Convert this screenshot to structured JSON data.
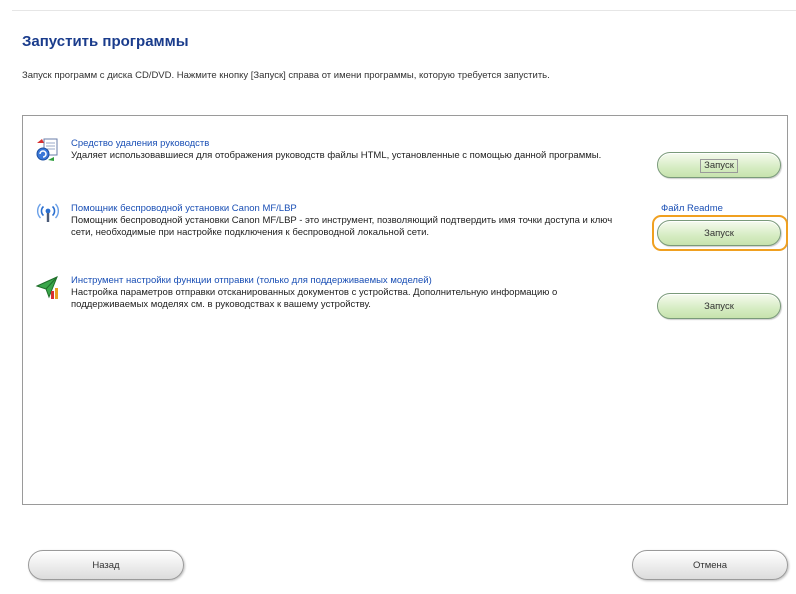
{
  "page": {
    "title": "Запустить программы",
    "instructions": "Запуск программ с диска CD/DVD. Нажмите кнопку [Запуск] справа от имени программы, которую требуется запустить."
  },
  "programs": [
    {
      "icon": "manual-uninstall-icon",
      "title": "Средство удаления руководств",
      "description": "Удаляет использовавшиеся для отображения руководств файлы HTML, установленные с помощью данной программы.",
      "launch_label": "Запуск"
    },
    {
      "icon": "wireless-setup-icon",
      "title": "Помощник беспроводной установки Canon MF/LBP",
      "description": "Помощник беспроводной установки Canon MF/LBP - это инструмент, позволяющий подтвердить имя точки доступа и ключ сети, необходимые при настройке подключения к беспроводной локальной сети.",
      "readme_label": "Файл Readme",
      "launch_label": "Запуск"
    },
    {
      "icon": "send-settings-icon",
      "title": "Инструмент настройки функции отправки (только для поддерживаемых моделей)",
      "description": "Настройка параметров отправки отсканированных документов с устройства. Дополнительную информацию о поддерживаемых моделях см. в руководствах к вашему устройству.",
      "launch_label": "Запуск"
    }
  ],
  "footer": {
    "back_label": "Назад",
    "cancel_label": "Отмена"
  },
  "colors": {
    "title": "#1a3c8c",
    "link": "#1a4fb5",
    "highlight": "#f0a020",
    "launch_button": "#d6ecc3"
  }
}
